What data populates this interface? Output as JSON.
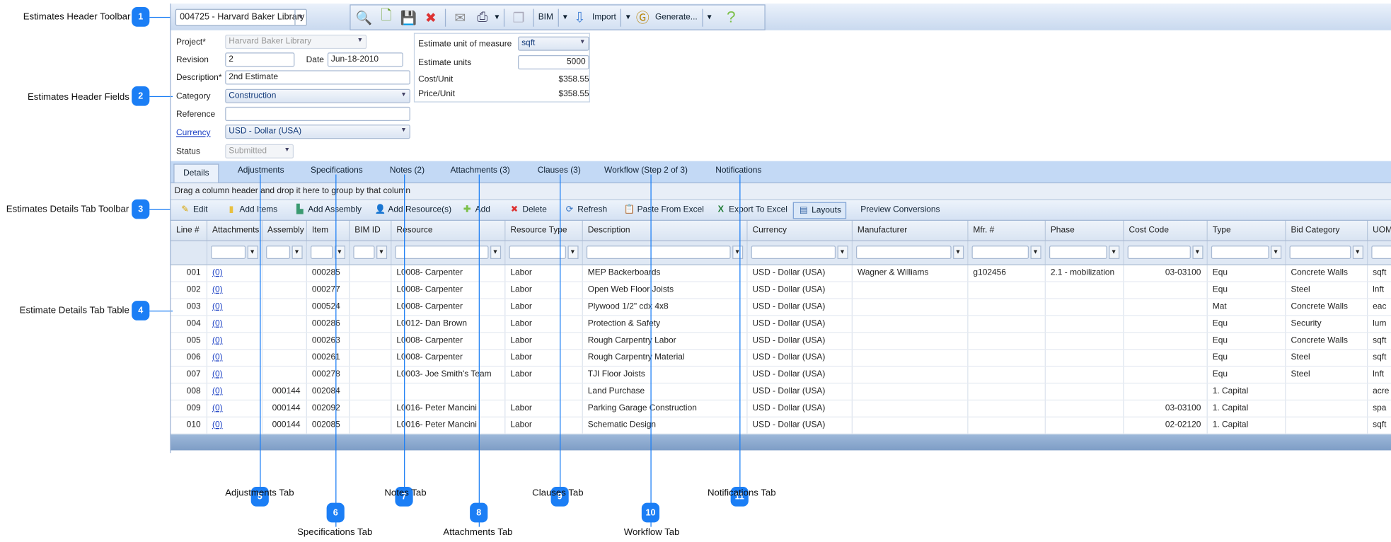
{
  "callouts": {
    "left": [
      {
        "num": "1",
        "label": "Estimates Header Toolbar"
      },
      {
        "num": "2",
        "label": "Estimates Header Fields"
      },
      {
        "num": "3",
        "label": "Estimates Details Tab Toolbar"
      },
      {
        "num": "4",
        "label": "Estimate Details Tab Table"
      }
    ],
    "bottom": [
      {
        "num": "5",
        "label": "Adjustments Tab"
      },
      {
        "num": "6",
        "label": "Specifications Tab"
      },
      {
        "num": "7",
        "label": "Notes Tab"
      },
      {
        "num": "8",
        "label": "Attachments Tab"
      },
      {
        "num": "9",
        "label": "Clauses Tab"
      },
      {
        "num": "10",
        "label": "Workflow Tab"
      },
      {
        "num": "11",
        "label": "Notifications Tab"
      }
    ],
    "color": "#1b7ef5"
  },
  "toolbar": {
    "estimate_select": "004725 - Harvard Baker Library -",
    "icons": [
      "search-icon",
      "new-document-icon",
      "save-icon",
      "delete-document-icon",
      "email-icon",
      "print-icon",
      "copy-icon"
    ],
    "bim": "BIM",
    "import": "Import",
    "generate": "Generate...",
    "help": "?"
  },
  "fields": {
    "project_label": "Project*",
    "project": "Harvard Baker Library",
    "revision_label": "Revision",
    "revision": "2",
    "date_label": "Date",
    "date": "Jun-18-2010",
    "description_label": "Description*",
    "description": "2nd Estimate",
    "category_label": "Category",
    "category": "Construction",
    "reference_label": "Reference",
    "reference": "",
    "currency_label": "Currency",
    "currency": "USD - Dollar (USA)",
    "status_label": "Status",
    "status": "Submitted",
    "uom_label": "Estimate unit of measure",
    "uom": "sqft",
    "units_label": "Estimate units",
    "units": "5000",
    "cost_unit_label": "Cost/Unit",
    "cost_unit": "$358.55",
    "price_unit_label": "Price/Unit",
    "price_unit": "$358.55"
  },
  "tabs": [
    "Details",
    "Adjustments",
    "Specifications",
    "Notes (2)",
    "Attachments (3)",
    "Clauses (3)",
    "Workflow (Step 2 of 3)",
    "Notifications"
  ],
  "active_tab": "Details",
  "group_hint": "Drag a column header and drop it here to group by that column",
  "details_toolbar": [
    "Edit",
    "Add Items",
    "Add Assembly",
    "Add Resource(s)",
    "Add",
    "Delete",
    "Refresh",
    "Paste From Excel",
    "Export To Excel",
    "Layouts",
    "Preview Conversions"
  ],
  "table": {
    "columns": [
      "Line #",
      "Attachments",
      "Assembly",
      "Item",
      "BIM ID",
      "Resource",
      "Resource Type",
      "Description",
      "Currency",
      "Manufacturer",
      "Mfr. #",
      "Phase",
      "Cost Code",
      "Type",
      "Bid Category",
      "UOM"
    ],
    "rows": [
      [
        "001",
        "(0)",
        "",
        "000285",
        "",
        "L0008- Carpenter",
        "Labor",
        "MEP Backerboards",
        "USD - Dollar (USA)",
        "Wagner & Williams",
        "g102456",
        "2.1 - mobilization",
        "03-03100",
        "Equ",
        "Concrete Walls",
        "sqft"
      ],
      [
        "002",
        "(0)",
        "",
        "000277",
        "",
        "L0008- Carpenter",
        "Labor",
        "Open Web Floor Joists",
        "USD - Dollar (USA)",
        "",
        "",
        "",
        "",
        "Equ",
        "Steel",
        "lnft"
      ],
      [
        "003",
        "(0)",
        "",
        "000524",
        "",
        "L0008- Carpenter",
        "Labor",
        "Plywood 1/2\" cdx 4x8",
        "USD - Dollar (USA)",
        "",
        "",
        "",
        "",
        "Mat",
        "Concrete Walls",
        "eac"
      ],
      [
        "004",
        "(0)",
        "",
        "000286",
        "",
        "L0012- Dan Brown",
        "Labor",
        "Protection & Safety",
        "USD - Dollar (USA)",
        "",
        "",
        "",
        "",
        "Equ",
        "Security",
        "lum"
      ],
      [
        "005",
        "(0)",
        "",
        "000263",
        "",
        "L0008- Carpenter",
        "Labor",
        "Rough Carpentry Labor",
        "USD - Dollar (USA)",
        "",
        "",
        "",
        "",
        "Equ",
        "Concrete Walls",
        "sqft"
      ],
      [
        "006",
        "(0)",
        "",
        "000261",
        "",
        "L0008- Carpenter",
        "Labor",
        "Rough Carpentry Material",
        "USD - Dollar (USA)",
        "",
        "",
        "",
        "",
        "Equ",
        "Steel",
        "sqft"
      ],
      [
        "007",
        "(0)",
        "",
        "000278",
        "",
        "L0003- Joe Smith's Team",
        "Labor",
        "TJI Floor Joists",
        "USD - Dollar (USA)",
        "",
        "",
        "",
        "",
        "Equ",
        "Steel",
        "lnft"
      ],
      [
        "008",
        "(0)",
        "000144",
        "002084",
        "",
        "",
        "",
        "Land Purchase",
        "USD - Dollar (USA)",
        "",
        "",
        "",
        "",
        "1. Capital",
        "",
        "acre"
      ],
      [
        "009",
        "(0)",
        "000144",
        "002092",
        "",
        "L0016- Peter Mancini",
        "Labor",
        "Parking Garage Construction",
        "USD - Dollar (USA)",
        "",
        "",
        "",
        "03-03100",
        "1. Capital",
        "",
        "spa"
      ],
      [
        "010",
        "(0)",
        "000144",
        "002085",
        "",
        "L0016- Peter Mancini",
        "Labor",
        "Schematic Design",
        "USD - Dollar (USA)",
        "",
        "",
        "",
        "02-02120",
        "1. Capital",
        "",
        "sqft"
      ]
    ]
  }
}
